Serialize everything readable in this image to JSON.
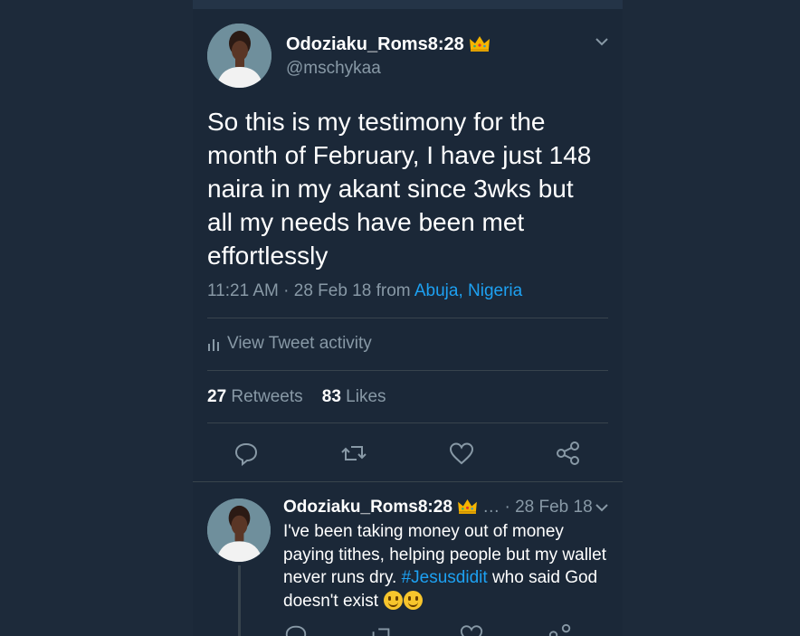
{
  "tweet": {
    "display_name": "Odoziaku_Roms8:28",
    "handle": "@mschykaa",
    "text": "So this is my testimony for the month of February, I have just 148 naira in my akant since 3wks but all my needs have been met effortlessly",
    "time": "11:21 AM · 28 Feb 18",
    "from_label": "from",
    "location": "Abuja, Nigeria",
    "activity_label": "View Tweet activity",
    "retweet_count": "27",
    "retweet_label": "Retweets",
    "like_count": "83",
    "like_label": "Likes"
  },
  "reply": {
    "display_name": "Odoziaku_Roms8:28",
    "ellipsis": "…",
    "date": "· 28 Feb 18",
    "text_before": "I've been taking money out of money paying tithes, helping people but my wallet never runs dry.",
    "hashtag": "#Jesusdidit",
    "text_after": "who said God doesn't exist"
  },
  "icons": {
    "crown": "crown-emoji",
    "caret": "chevron-down-icon",
    "reply": "reply-icon",
    "retweet": "retweet-icon",
    "like": "heart-icon",
    "share": "share-icon",
    "activity": "bar-chart-icon"
  },
  "colors": {
    "background": "#1b2838",
    "link": "#1da1f2",
    "secondary_text": "#8899a6",
    "divider": "#38444d"
  }
}
